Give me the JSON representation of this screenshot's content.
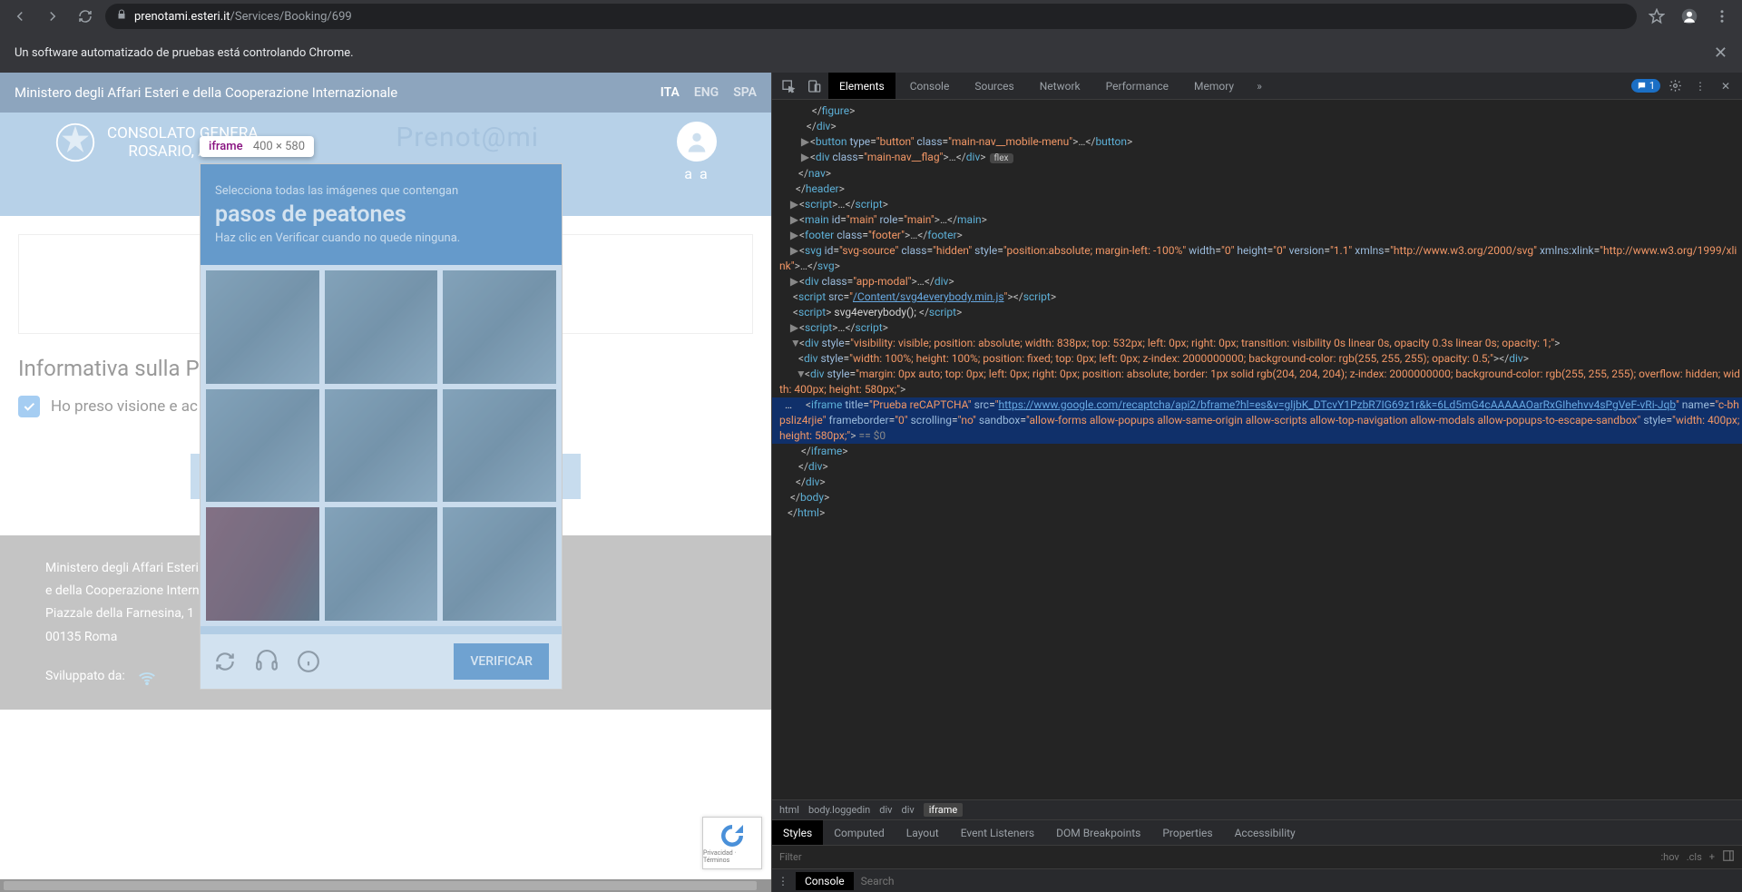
{
  "browser": {
    "url_host": "prenotami.esteri.it",
    "url_path": "/Services/Booking/699",
    "automation_banner": "Un software automatizado de pruebas está controlando Chrome."
  },
  "page": {
    "ministry": "Ministero degli Affari Esteri e della Cooperazione Internazionale",
    "languages": [
      "ITA",
      "ENG",
      "SPA"
    ],
    "active_language": "ITA",
    "brand": "Prenot@mi",
    "consulate_line1": "CONSOLATO GENERA",
    "consulate_line2": "ROSARIO, ARGE",
    "user_label": "a a",
    "privacy_heading": "Informativa sulla Priv",
    "privacy_ack": "Ho preso visione e ac",
    "footer_l1": "Ministero degli Affari Esteri",
    "footer_l2": "e della Cooperazione Internazi",
    "footer_l3": "Piazzale della Farnesina, 1",
    "footer_l4": "00135 Roma",
    "footer_dev": "Sviluppato da:"
  },
  "captcha": {
    "instruction": "Selecciona todas las imágenes que contengan",
    "target": "pasos de peatones",
    "sub": "Haz clic en Verificar cuando no quede ninguna.",
    "verify": "VERIFICAR",
    "badge_line1": "Privacidad · Términos"
  },
  "inspector": {
    "tooltip_tag": "iframe",
    "tooltip_dims": "400 × 580"
  },
  "devtools": {
    "tabs": [
      "Elements",
      "Console",
      "Sources",
      "Network",
      "Performance",
      "Memory"
    ],
    "active_tab": "Elements",
    "issues_count": "1",
    "breadcrumb": [
      "html",
      "body.loggedin",
      "div",
      "div",
      "iframe"
    ],
    "styles_tabs": [
      "Styles",
      "Computed",
      "Layout",
      "Event Listeners",
      "DOM Breakpoints",
      "Properties",
      "Accessibility"
    ],
    "filter_placeholder": "Filter",
    "filter_actions": [
      ":hov",
      ".cls",
      "+"
    ],
    "console_label": "Console",
    "search_placeholder": "Search",
    "iframe_url": "https://www.google.com/recaptcha/api2/bframe?hl=es&v=gljbK_DTcvY1PzbR7IG69z1r&k=6Ld5mG4cAAAAAOarRxGIhehvv4sPgVeF-vRi-Jqb",
    "svg4e_url": "/Content/svg4everybody.min.js",
    "svg_xmlns": "http://www.w3.org/2000/svg",
    "svg_xlink": "http://www.w3.org/1999/xlink"
  }
}
